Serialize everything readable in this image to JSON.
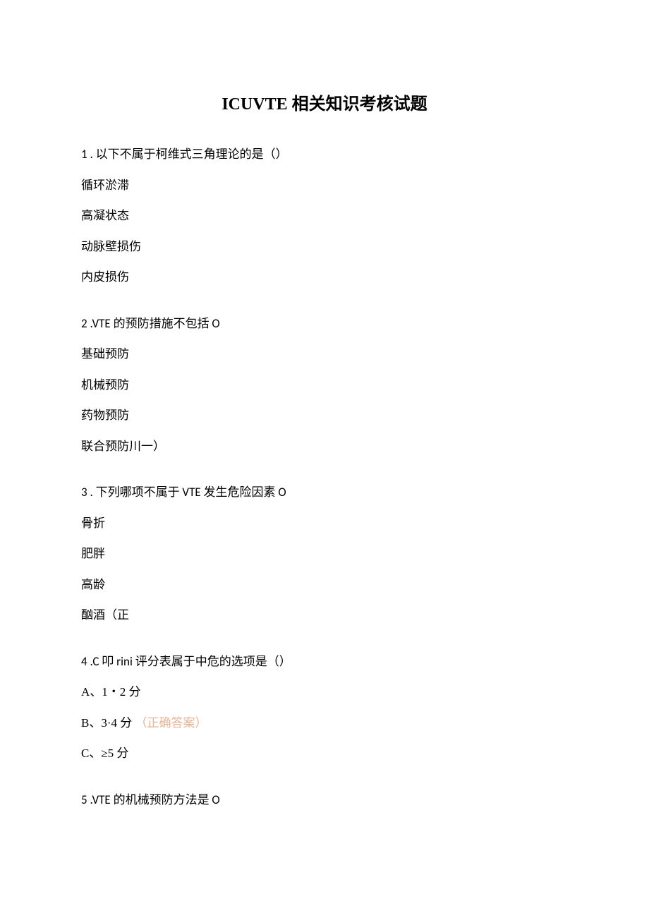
{
  "title": "ICUVTE 相关知识考核试题",
  "q1": {
    "stem": "1 . 以下不属于柯维式三角理论的是（）",
    "opts": [
      "循环淤滞",
      "高凝状态",
      "动脉壁损伤",
      "内皮损伤"
    ]
  },
  "q2": {
    "stem": "2  .VTE 的预防措施不包括 O",
    "opts": [
      "基础预防",
      "机械预防",
      "药物预防",
      "联合预防川一）"
    ]
  },
  "q3": {
    "stem": "3  . 下列哪项不属于 VTE 发生危险因素 O",
    "opts": [
      "骨折",
      "肥胖",
      "高龄",
      "酗酒（正"
    ]
  },
  "q4": {
    "stem": "4  .C 叩 rini 评分表属于中危的选项是（）",
    "optA": "A、1・2 分",
    "optB_text": "B、3·4 分",
    "optB_mark": "（正确答案）",
    "optC": "C、≥5 分"
  },
  "q5": {
    "stem": "5  .VTE 的机械预防方法是 O"
  }
}
